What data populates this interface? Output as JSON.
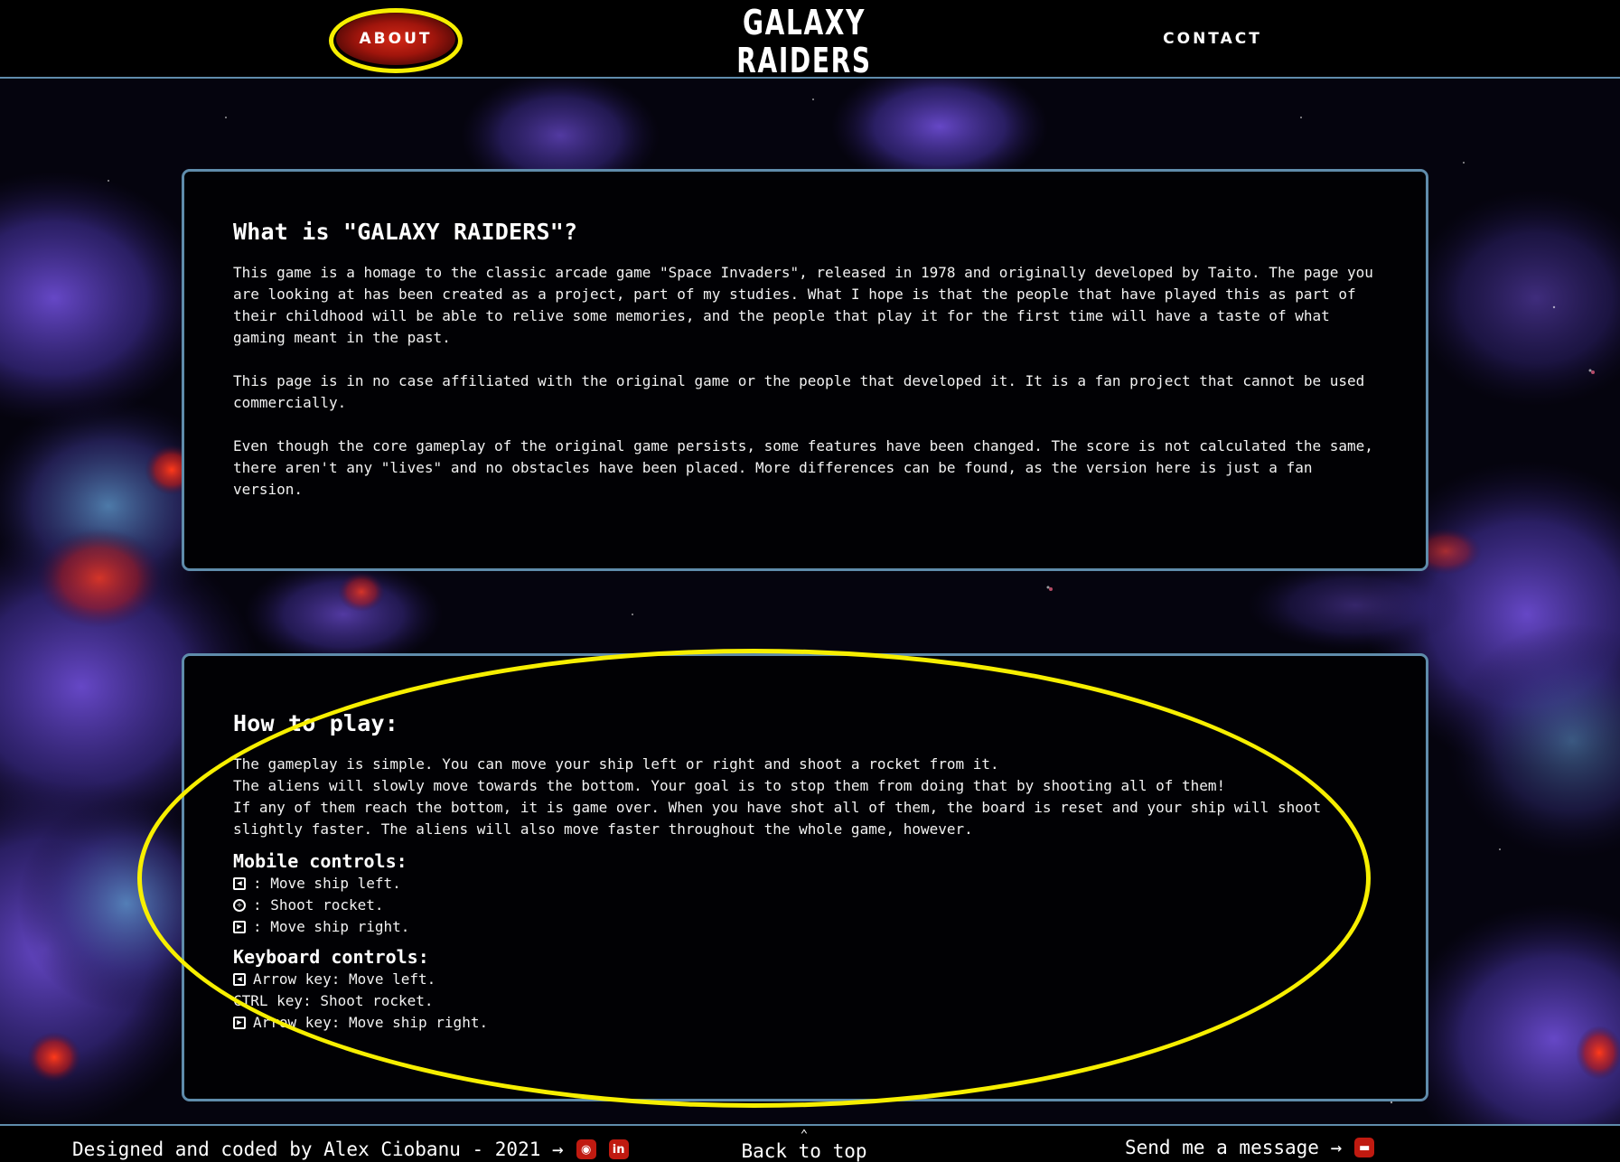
{
  "header": {
    "nav_about": "ABOUT",
    "nav_contact": "CONTACT",
    "logo_line1": "GALAXY",
    "logo_line2": "RAIDERS"
  },
  "about": {
    "title": "What is \"GALAXY RAIDERS\"?",
    "paragraphs": [
      "This game is a homage to the classic arcade game \"Space Invaders\", released in 1978 and originally developed by Taito. The page you are looking at has been created as a project, part of my studies. What I hope is that the people that have played this as part of their childhood will be able to relive some memories, and the people that play it for the first time will have a taste of what gaming meant in the past.",
      "This page is in no case affiliated with the original game or the people that developed it. It is a fan project that cannot be used commercially.",
      "Even though the core gameplay of the original game persists, some features have been changed. The score is not calculated the same, there aren't any \"lives\" and no obstacles have been placed. More differences can be found, as the version here is just a fan version."
    ]
  },
  "howto": {
    "title": "How to play:",
    "lines": [
      "The gameplay is simple. You can move your ship left or right and shoot a rocket from it.",
      "The aliens will slowly move towards the bottom. Your goal is to stop them from doing that by shooting all of them!",
      "If any of them reach the bottom, it is game over. When you have shot all of them, the board is reset and your ship will shoot slightly faster. The aliens will also move faster throughout the whole game, however."
    ],
    "mobile_title": "Mobile controls:",
    "mobile": [
      {
        "icon": "arrow-left-square-icon",
        "glyph": "◀",
        "text": ": Move ship left."
      },
      {
        "icon": "crosshair-icon",
        "glyph": "✛",
        "text": ": Shoot rocket."
      },
      {
        "icon": "arrow-right-square-icon",
        "glyph": "▶",
        "text": ": Move ship right."
      }
    ],
    "keyboard_title": "Keyboard controls:",
    "keyboard": [
      {
        "icon": "arrow-left-square-icon",
        "glyph": "◀",
        "text": "Arrow key: Move left."
      },
      {
        "icon": "",
        "glyph": "",
        "text": "CTRL key: Shoot rocket."
      },
      {
        "icon": "arrow-right-square-icon",
        "glyph": "▶",
        "text": "Arrow key: Move ship right."
      }
    ]
  },
  "footer": {
    "credit": "Designed and coded by Alex Ciobanu - 2021 →",
    "back_to_top": "Back to top",
    "message": "Send me a message →",
    "icons": [
      "github-icon",
      "linkedin-icon",
      "chat-bubble-icon"
    ]
  },
  "colors": {
    "border": "#5f8cab",
    "annotation": "#f7ef00",
    "about_button": "#c01a10"
  }
}
